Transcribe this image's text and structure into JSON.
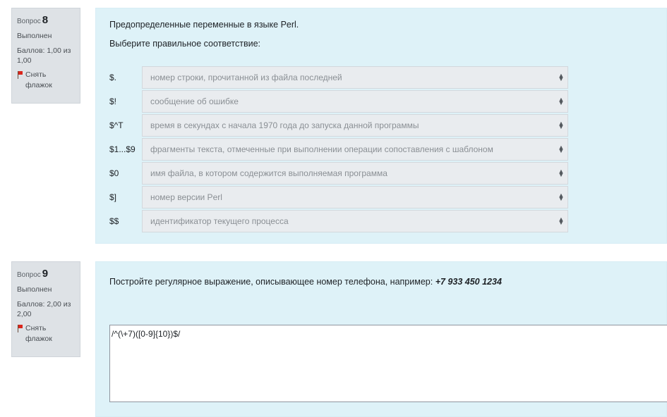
{
  "questions": [
    {
      "label": "Вопрос",
      "number": "8",
      "state": "Выполнен",
      "grade": "Баллов: 1,00 из 1,00",
      "flag": "Снять флажок",
      "text": "Предопределенные переменные в языке Perl.",
      "prompt": "Выберите правильное соответствие:",
      "rows": [
        {
          "stem": "$.",
          "selected": "номер строки, прочитанной из файла последней"
        },
        {
          "stem": "$!",
          "selected": "сообщение об ошибке"
        },
        {
          "stem": "$^T",
          "selected": "время в секундах с начала 1970 года до запуска данной программы"
        },
        {
          "stem": "$1...$9",
          "selected": "фрагменты текста, отмеченные при выполнении операции сопоставления с шаблоном"
        },
        {
          "stem": "$0",
          "selected": "имя файла, в котором содержится выполняемая программа"
        },
        {
          "stem": "$]",
          "selected": "номер версии Perl"
        },
        {
          "stem": "$$",
          "selected": "идентификатор текущего процесса"
        }
      ]
    },
    {
      "label": "Вопрос",
      "number": "9",
      "state": "Выполнен",
      "grade": "Баллов: 2,00 из 2,00",
      "flag": "Снять флажок",
      "text": "Постройте регулярное выражение, описывающее номер телефона, например:",
      "example": "+7 933 450 1234",
      "answer": "/^(\\+7)([0-9]{10})$/"
    }
  ],
  "icons": {
    "flag": "flag-icon",
    "select_caret": "chevron-up-down-icon"
  },
  "colors": {
    "content_bg": "#def2f8",
    "info_bg": "#dee2e6",
    "flag": "#d9261c"
  }
}
